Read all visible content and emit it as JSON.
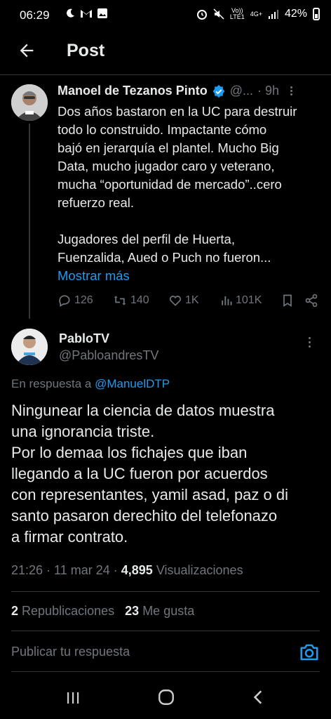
{
  "status_bar": {
    "time": "06:29",
    "network": "4G+",
    "carrier_label": "LTE1",
    "volte": "Vo))",
    "battery": "42%"
  },
  "header": {
    "title": "Post"
  },
  "parent_tweet": {
    "name": "Manoel de Tezanos Pinto",
    "handle": "@...",
    "time": "· 9h",
    "text_lines": [
      "Dos años bastaron en la UC para destruir",
      "todo lo construido. Impactante cómo",
      "bajó en jerarquía el plantel. Mucho Big",
      "Data, mucho jugador caro y veterano,",
      "mucha “oportunidad de mercado”..cero",
      "refuerzo real."
    ],
    "text_lines_2": [
      "Jugadores del perfil de Huerta,",
      "Fuenzalida, Aued o Puch no fueron..."
    ],
    "show_more": "Mostrar más",
    "replies": "126",
    "reposts": "140",
    "likes": "1K",
    "views": "101K"
  },
  "reply": {
    "name": "PabloTV",
    "handle": "@PabloandresTV",
    "replying_to_prefix": "En respuesta a",
    "replying_to_handle": "@ManuelDTP",
    "text_lines": [
      "Ningunear la ciencia de datos muestra",
      "una ignorancia triste.",
      "Por lo demaa los fichajes que iban",
      "llegando a la UC fueron por acuerdos",
      "con representantes, yamil asad, paz o di",
      "santo pasaron derechito del telefonazo",
      "a firmar contrato."
    ],
    "timestamp": "21:26 · 11 mar 24 ·",
    "views_count": "4,895",
    "views_label": "Visualizaciones",
    "reposts_count": "2",
    "reposts_label": "Republicaciones",
    "likes_count": "23",
    "likes_label": "Me gusta"
  },
  "compose": {
    "placeholder": "Publicar tu respuesta"
  },
  "colors": {
    "accent": "#1d9bf0",
    "background": "#000000",
    "muted": "#71767b",
    "text": "#e7e9ea"
  },
  "icons": [
    "back-arrow-icon",
    "verified-badge-icon",
    "reply-icon",
    "repost-icon",
    "like-icon",
    "views-icon",
    "bookmark-icon",
    "share-icon",
    "camera-icon",
    "recent-apps-icon",
    "home-icon",
    "nav-back-icon"
  ]
}
